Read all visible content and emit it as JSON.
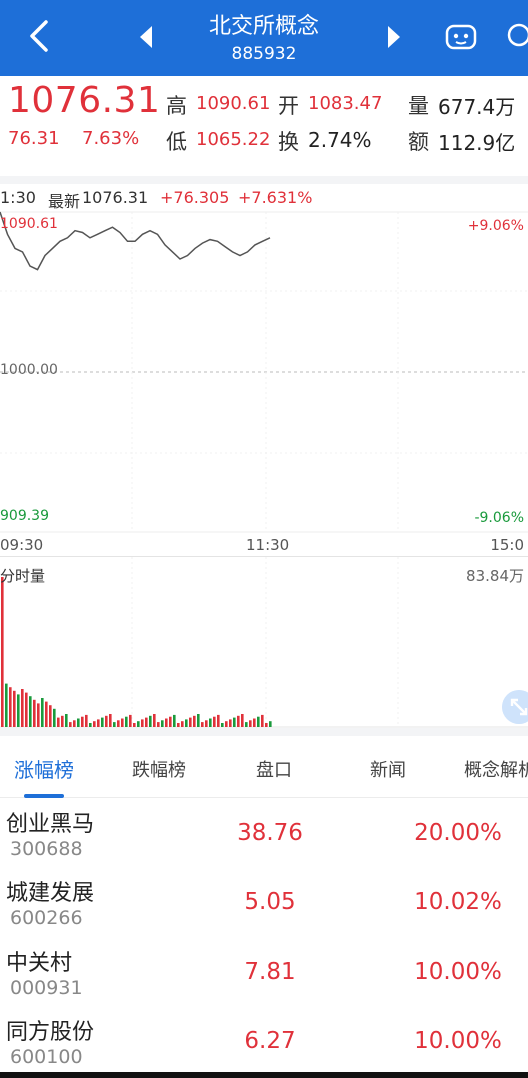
{
  "header": {
    "title": "北交所概念",
    "code": "885932"
  },
  "quote": {
    "price": "1076.31",
    "change": "76.31",
    "change_pct": "7.63%",
    "high_label": "高",
    "high": "1090.61",
    "open_label": "开",
    "open": "1083.47",
    "volume_label": "量",
    "volume": "677.4万",
    "low_label": "低",
    "low": "1065.22",
    "turnover_label": "换",
    "turnover": "2.74%",
    "amount_label": "额",
    "amount": "112.9亿"
  },
  "chart": {
    "time_prefix": "1:30",
    "latest_label": "最新",
    "latest": "1076.31",
    "delta": "+76.305",
    "delta_pct": "+7.631%",
    "upper_price": "1090.61",
    "upper_pct": "+9.06%",
    "mid_price": "1000.00",
    "lower_price": "909.39",
    "lower_pct": "-9.06%",
    "time_start": "09:30",
    "time_mid": "11:30",
    "time_end": "15:0",
    "vol_title": "分时量",
    "vol_max": "83.84万"
  },
  "chart_data": {
    "type": "line",
    "ylim": [
      909.39,
      1090.61
    ],
    "series": [
      {
        "values": [
          1090.6,
          1078,
          1070,
          1068,
          1060,
          1058,
          1066,
          1070,
          1074,
          1076,
          1080,
          1079,
          1076,
          1078,
          1080,
          1082,
          1079,
          1074,
          1074,
          1078,
          1080,
          1078,
          1072,
          1068,
          1064,
          1066,
          1070,
          1073,
          1075,
          1074,
          1071,
          1068,
          1066,
          1068,
          1072,
          1074,
          1076
        ]
      }
    ]
  },
  "tabs": [
    "涨幅榜",
    "跌幅榜",
    "盘口",
    "新闻",
    "概念解析"
  ],
  "stocks": [
    {
      "name": "创业黑马",
      "code": "300688",
      "price": "38.76",
      "pct": "20.00%"
    },
    {
      "name": "城建发展",
      "code": "600266",
      "price": "5.05",
      "pct": "10.02%"
    },
    {
      "name": "中关村",
      "code": "000931",
      "price": "7.81",
      "pct": "10.00%"
    },
    {
      "name": "同方股份",
      "code": "600100",
      "price": "6.27",
      "pct": "10.00%"
    }
  ],
  "colors": {
    "brand": "#1e6fd8",
    "up": "#e0313a",
    "down": "#1a9a3c"
  }
}
